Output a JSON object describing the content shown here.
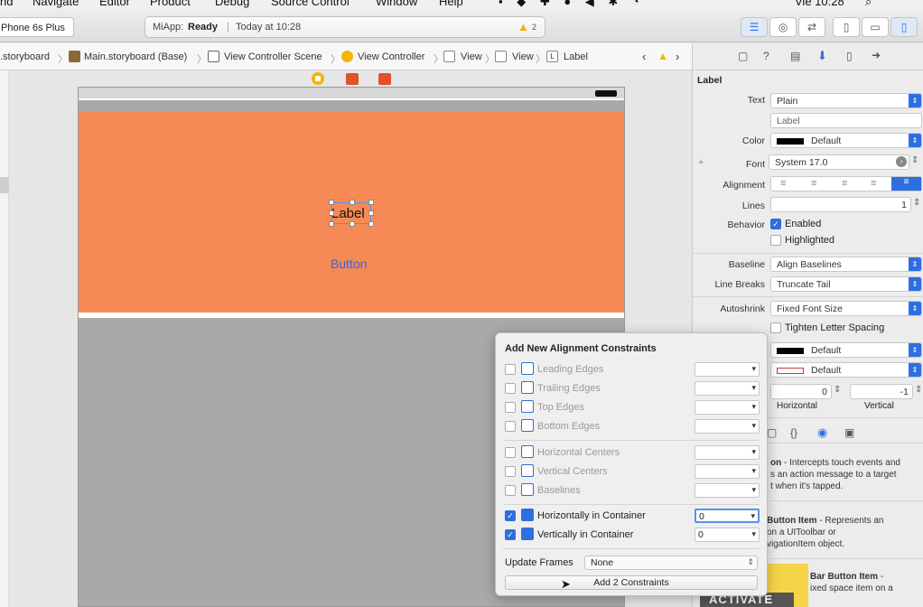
{
  "menubar": {
    "items": [
      "nd",
      "Navigate",
      "Editor",
      "Product",
      "Debug",
      "Source Control",
      "Window",
      "Help"
    ],
    "clock": "Vie 10:28"
  },
  "toolbar": {
    "scheme_device": "Phone 6s Plus",
    "activity": {
      "app": "MiApp:",
      "status": "Ready",
      "divider": "|",
      "time": "Today at 10:28",
      "warning_count": "2"
    }
  },
  "breadcrumb": {
    "items": [
      ".storyboard",
      "Main.storyboard (Base)",
      "View Controller Scene",
      "View Controller",
      "View",
      "View",
      "Label"
    ],
    "label_glyph": "L"
  },
  "canvas": {
    "label_text": "Label",
    "button_text": "Button",
    "accent_color": "#f58a56"
  },
  "inspector": {
    "title": "Label",
    "text_label": "Text",
    "text_value": "Plain",
    "text_field": "Label",
    "color_label": "Color",
    "color_value": "Default",
    "font_label": "Font",
    "font_value": "System 17.0",
    "alignment_label": "Alignment",
    "lines_label": "Lines",
    "lines_value": "1",
    "behavior_label": "Behavior",
    "enabled_label": "Enabled",
    "highlighted_label": "Highlighted",
    "baseline_label": "Baseline",
    "baseline_value": "Align Baselines",
    "linebreaks_label": "Line Breaks",
    "linebreaks_value": "Truncate Tail",
    "autoshrink_label": "Autoshrink",
    "autoshrink_value": "Fixed Font Size",
    "tighten_label": "Tighten Letter Spacing",
    "highlight_color_value": "Default",
    "shadow_color_value": "Default",
    "shadow_h": "0",
    "shadow_v": "-1",
    "horizontal_label": "Horizontal",
    "vertical_label": "Vertical",
    "library_glyph": "{}",
    "library": [
      {
        "title": "on",
        "desc1": " - Intercepts touch events and",
        "desc2": "s an action message to a target",
        "desc3": "t when it's tapped."
      },
      {
        "title": "Button Item",
        "desc1": " - Represents an",
        "desc2": "on a UIToolbar or",
        "desc3": "vigationItem object."
      },
      {
        "title": "Bar Button Item",
        "desc1": " -",
        "desc2": "ixed space item on a",
        "desc3": ""
      }
    ]
  },
  "popup": {
    "title": "Add New Alignment Constraints",
    "rows": [
      {
        "label": "Leading Edges",
        "checked": false,
        "value": ""
      },
      {
        "label": "Trailing Edges",
        "checked": false,
        "value": ""
      },
      {
        "label": "Top Edges",
        "checked": false,
        "value": ""
      },
      {
        "label": "Bottom Edges",
        "checked": false,
        "value": ""
      },
      {
        "label": "Horizontal Centers",
        "checked": false,
        "value": ""
      },
      {
        "label": "Vertical Centers",
        "checked": false,
        "value": ""
      },
      {
        "label": "Baselines",
        "checked": false,
        "value": ""
      },
      {
        "label": "Horizontally in Container",
        "checked": true,
        "value": "0"
      },
      {
        "label": "Vertically in Container",
        "checked": true,
        "value": "0"
      }
    ],
    "update_frames_label": "Update Frames",
    "update_frames_value": "None",
    "add_button": "Add 2 Constraints"
  },
  "watermark": "ACTIVATE",
  "colors": {
    "accent_blue": "#2d6fe0",
    "warning": "#f0b400",
    "view_orange": "#f58a56"
  }
}
